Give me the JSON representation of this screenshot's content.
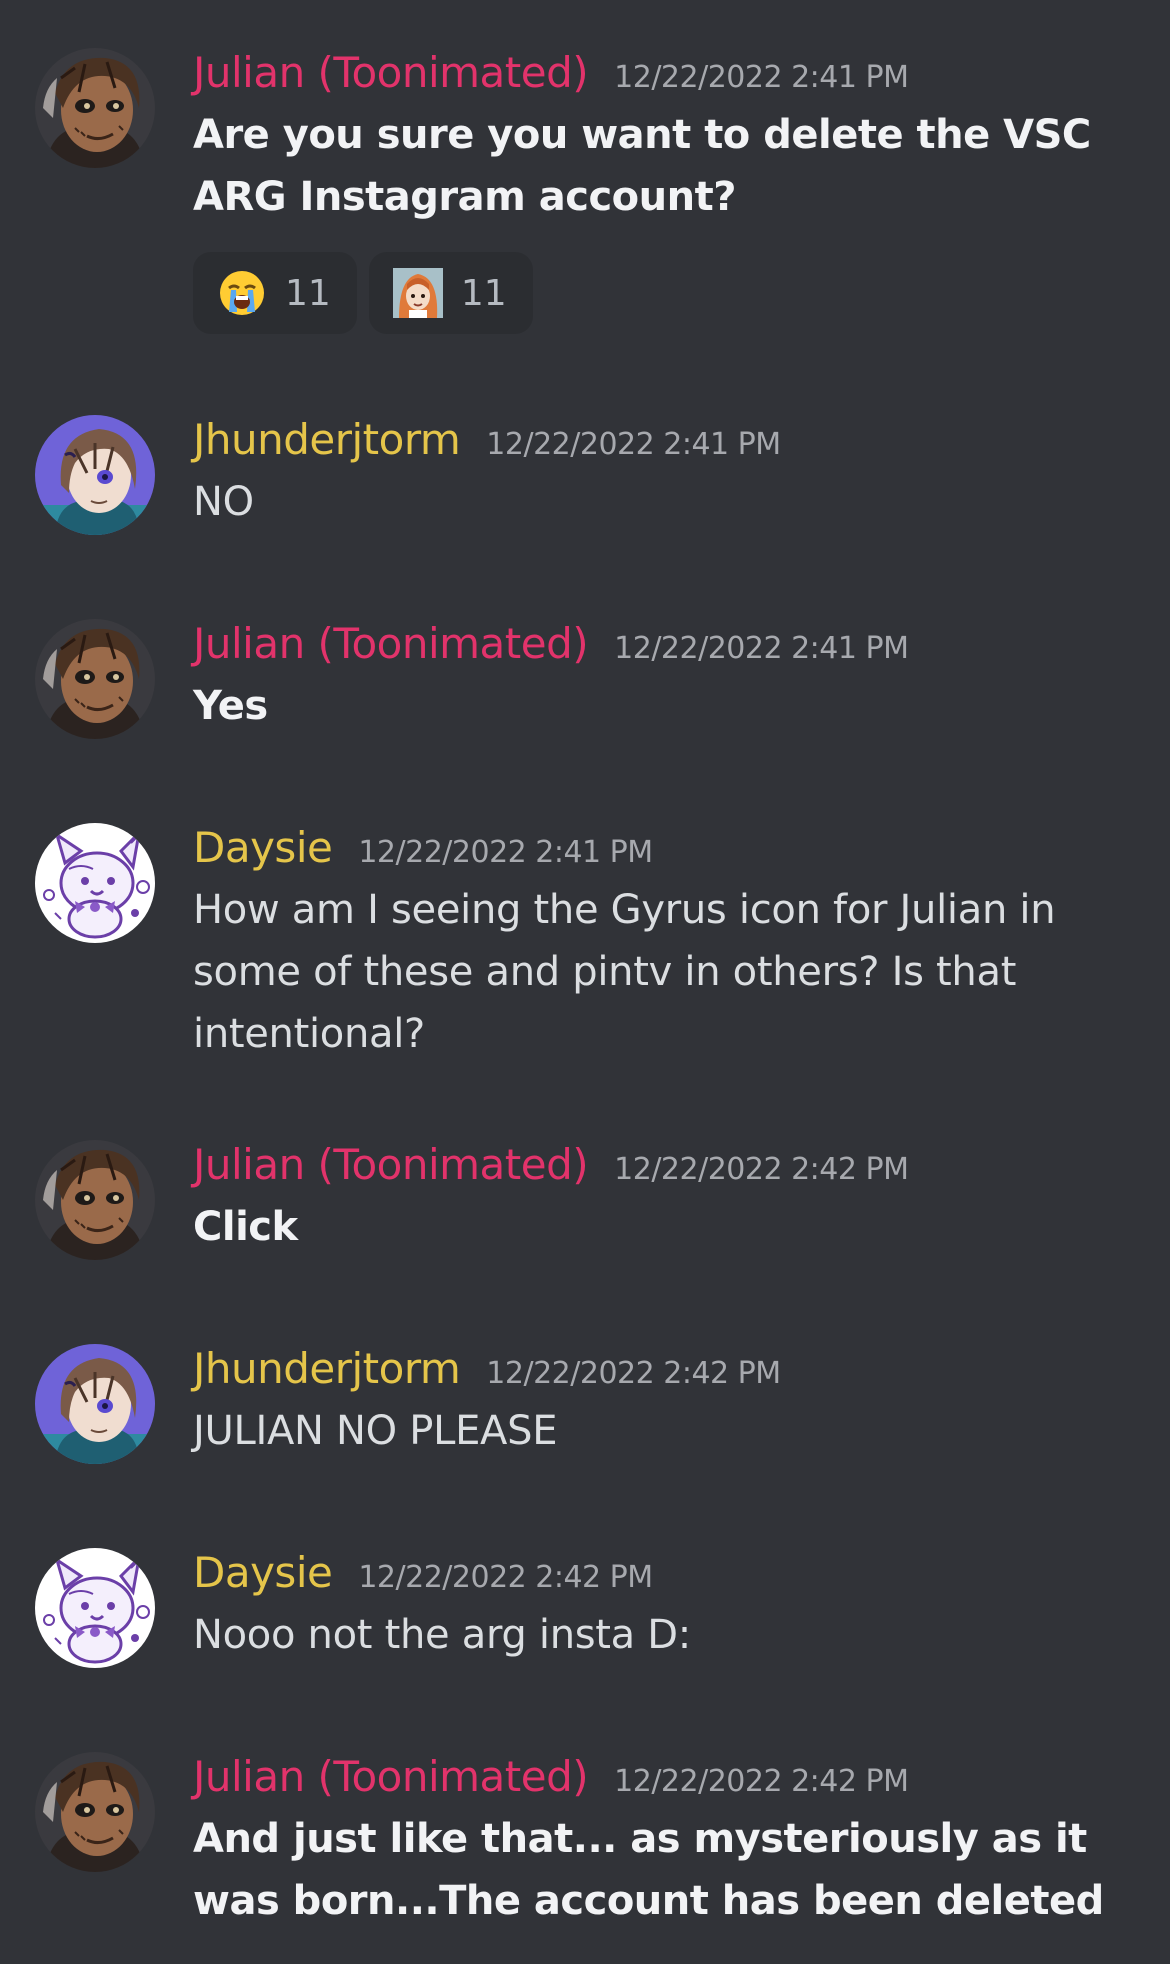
{
  "colors": {
    "background": "#313338",
    "name_pink": "#e2336b",
    "name_yellow": "#e5c54a",
    "timestamp": "#a7a9ae",
    "text": "#dbdee1",
    "reaction_bg": "#2b2d31"
  },
  "messages": [
    {
      "author": "Julian (Toonimated)",
      "timestamp": "12/22/2022 2:41 PM",
      "text": "Are you sure you want to delete the VSC ARG  Instagram account?",
      "reactions": [
        {
          "emoji": "loudly-crying-face-emoji",
          "count": "11"
        },
        {
          "emoji": "custom-character-emoji",
          "count": "11"
        }
      ]
    },
    {
      "author": "Jhunderjtorm",
      "timestamp": "12/22/2022 2:41 PM",
      "text": "NO"
    },
    {
      "author": "Julian (Toonimated)",
      "timestamp": "12/22/2022 2:41 PM",
      "text": "Yes"
    },
    {
      "author": "Daysie",
      "timestamp": "12/22/2022 2:41 PM",
      "text": "How am I seeing the Gyrus icon for Julian in some of these and pintv in others? Is that intentional?"
    },
    {
      "author": "Julian (Toonimated)",
      "timestamp": "12/22/2022 2:42 PM",
      "text": "Click"
    },
    {
      "author": "Jhunderjtorm",
      "timestamp": "12/22/2022 2:42 PM",
      "text": "JULIAN NO PLEASE"
    },
    {
      "author": "Daysie",
      "timestamp": "12/22/2022 2:42 PM",
      "text": "Nooo not the arg insta D:"
    },
    {
      "author": "Julian (Toonimated)",
      "timestamp": "12/22/2022 2:42 PM",
      "text": "And just like that... as mysteriously as it was born...The account has been deleted"
    }
  ]
}
